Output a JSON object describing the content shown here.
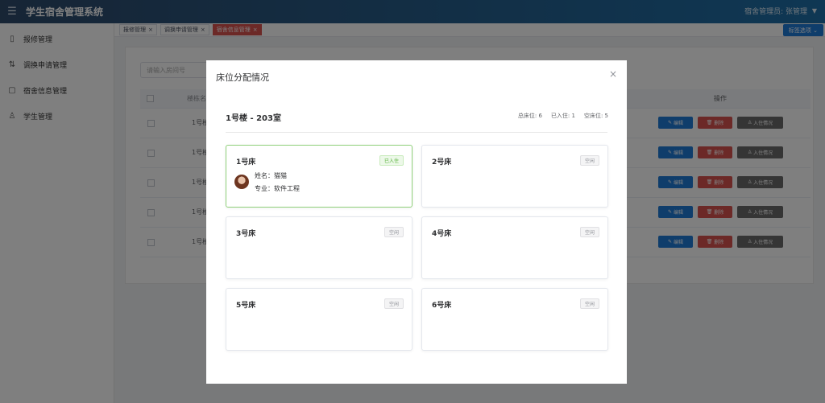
{
  "header": {
    "title": "学生宿舍管理系统",
    "user": "宿舍管理员: 张管理"
  },
  "sidebar": {
    "items": [
      {
        "label": "报修管理",
        "icon": "phone-icon"
      },
      {
        "label": "调换申请管理",
        "icon": "swap-icon"
      },
      {
        "label": "宿舍信息管理",
        "icon": "building-icon"
      },
      {
        "label": "学生管理",
        "icon": "user-icon"
      }
    ]
  },
  "tabs": [
    {
      "label": "报修管理"
    },
    {
      "label": "调换申请管理"
    },
    {
      "label": "宿舍信息管理"
    }
  ],
  "tab_options_label": "标签选项",
  "background": {
    "search_placeholder": "请输入房间号",
    "col_name": "楼栋名",
    "col_ops": "操作",
    "rows": [
      "1号楼",
      "1号楼",
      "1号楼",
      "1号楼",
      "1号楼"
    ],
    "edit_label": "编辑",
    "delete_label": "删除",
    "info_label": "入住情况"
  },
  "modal": {
    "title": "床位分配情况",
    "room": "1号楼 - 203室",
    "stats": {
      "total": "总床位: 6",
      "occupied": "已入住: 1",
      "vacant": "空床位: 5"
    },
    "beds": [
      {
        "name": "1号床",
        "status": "已入住",
        "occupant_name": "姓名：猫猫",
        "occupant_major": "专业：软件工程"
      },
      {
        "name": "2号床",
        "status": "空闲"
      },
      {
        "name": "3号床",
        "status": "空闲"
      },
      {
        "name": "4号床",
        "status": "空闲"
      },
      {
        "name": "5号床",
        "status": "空闲"
      },
      {
        "name": "6号床",
        "status": "空闲"
      }
    ]
  },
  "colors": {
    "header": "#1e6fa8",
    "primary": "#1f7ad6",
    "danger": "#d9534f",
    "occupied": "#5ab33d"
  }
}
